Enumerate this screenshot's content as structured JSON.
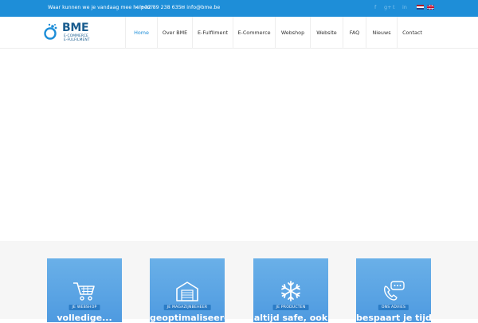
{
  "topbar": {
    "help_text": "Waar kunnen we je vandaag mee helpen?",
    "phone": "+32 89 238 635",
    "email": "info@bme.be",
    "social_icons": [
      "facebook-icon",
      "google-plus-icon",
      "twitter-icon",
      "linkedin-icon"
    ],
    "languages": [
      "nl",
      "en"
    ],
    "background_color": "#1e8ed8"
  },
  "logo": {
    "title": "BME",
    "subtitle_line1": "E-COMMERCE",
    "subtitle_line2": "E-FULFILMENT",
    "color": "#1a5d8f"
  },
  "nav": {
    "active_color": "#1e8ed8",
    "items": [
      {
        "label": "Home",
        "active": true
      },
      {
        "label": "Over BME",
        "active": false
      },
      {
        "label": "E-Fulfilment",
        "active": false
      },
      {
        "label": "E-Commerce",
        "active": false
      },
      {
        "label": "Webshop",
        "active": false
      },
      {
        "label": "Website",
        "active": false
      },
      {
        "label": "FAQ",
        "active": false
      },
      {
        "label": "Nieuws",
        "active": false
      },
      {
        "label": "Contact",
        "active": false
      }
    ]
  },
  "services": {
    "cards": [
      {
        "icon": "shopping-cart-icon",
        "tag": "Je webshop",
        "headline": "volledige..."
      },
      {
        "icon": "warehouse-icon",
        "tag": "Je magazijnbeheer",
        "headline": "geoptimaliseerd"
      },
      {
        "icon": "snowflake-icon",
        "tag": "Je producten",
        "headline": "altijd safe, ook"
      },
      {
        "icon": "chat-phone-icon",
        "tag": "Ons advies",
        "headline": "bespaart je tijd"
      }
    ]
  }
}
